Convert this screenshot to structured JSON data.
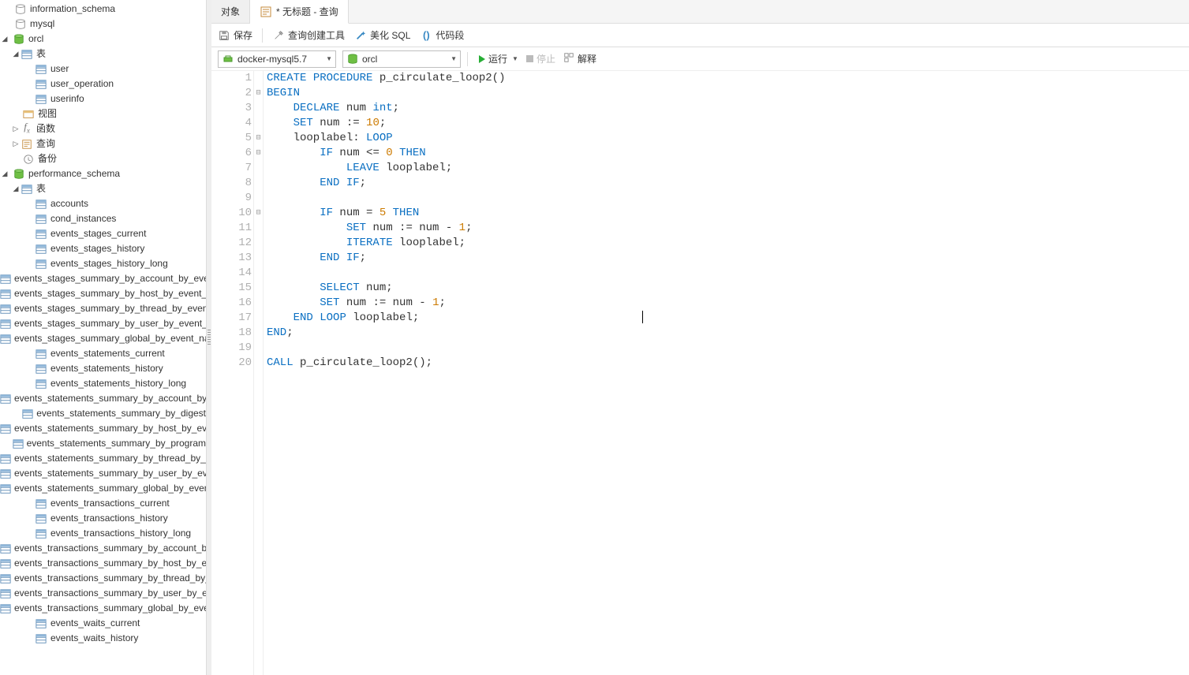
{
  "sidebar": {
    "info_schema": "information_schema",
    "mysql": "mysql",
    "orcl": "orcl",
    "tbl_group": "表",
    "user": "user",
    "user_operation": "user_operation",
    "userinfo": "userinfo",
    "view": "视图",
    "func": "函数",
    "query": "查询",
    "backup": "备份",
    "perf_schema": "performance_schema",
    "perf_tables_label": "表",
    "perf_tables": [
      "accounts",
      "cond_instances",
      "events_stages_current",
      "events_stages_history",
      "events_stages_history_long",
      "events_stages_summary_by_account_by_event_name",
      "events_stages_summary_by_host_by_event_name",
      "events_stages_summary_by_thread_by_event_name",
      "events_stages_summary_by_user_by_event_name",
      "events_stages_summary_global_by_event_name",
      "events_statements_current",
      "events_statements_history",
      "events_statements_history_long",
      "events_statements_summary_by_account_by_event_name",
      "events_statements_summary_by_digest",
      "events_statements_summary_by_host_by_event_name",
      "events_statements_summary_by_program",
      "events_statements_summary_by_thread_by_event_name",
      "events_statements_summary_by_user_by_event_name",
      "events_statements_summary_global_by_event_name",
      "events_transactions_current",
      "events_transactions_history",
      "events_transactions_history_long",
      "events_transactions_summary_by_account_by_event_name",
      "events_transactions_summary_by_host_by_event_name",
      "events_transactions_summary_by_thread_by_event_name",
      "events_transactions_summary_by_user_by_event_name",
      "events_transactions_summary_global_by_event_name",
      "events_waits_current",
      "events_waits_history"
    ]
  },
  "tabs": {
    "objects": "对象",
    "query_tab": "* 无标题 - 查询"
  },
  "toolbar": {
    "save": "保存",
    "query_builder": "查询创建工具",
    "beautify": "美化 SQL",
    "snippet": "代码段"
  },
  "conn": {
    "connection": "docker-mysql5.7",
    "database": "orcl",
    "run": "运行",
    "stop": "停止",
    "explain": "解释"
  },
  "code": {
    "lines": 20,
    "fold": {
      "2": "⊟",
      "5": "⊟",
      "6": "⊟",
      "10": "⊟"
    }
  }
}
